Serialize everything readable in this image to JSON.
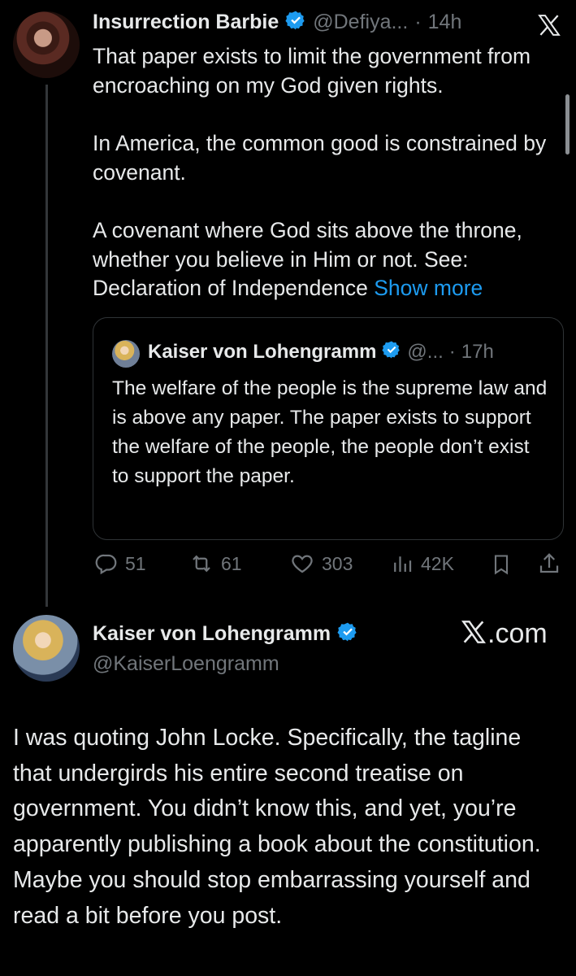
{
  "tweet": {
    "author_name": "Insurrection Barbie",
    "author_handle": "@Defiya...",
    "separator": "·",
    "time": "14h",
    "text": [
      "That paper exists to limit the government from encroaching on my God given rights.",
      "In America, the common good is constrained by covenant.",
      "A covenant where God sits above the throne, whether you believe in Him or not. See: Declaration of Independence"
    ],
    "show_more": "Show more",
    "quoted": {
      "author_name": "Kaiser von Lohengramm",
      "author_handle": "@...",
      "separator": "·",
      "time": "17h",
      "text": "The welfare of the people is the supreme law and is above any paper. The paper exists to support the welfare of the people, the people don’t exist to support the paper."
    },
    "actions": {
      "replies": "51",
      "reposts": "61",
      "likes": "303",
      "views": "42K"
    }
  },
  "reply": {
    "author_name": "Kaiser von Lohengramm",
    "author_handle": "@KaiserLoengramm",
    "watermark": "X.com",
    "text": "I was quoting John Locke. Specifically, the tagline that undergirds his entire second treatise on government. You didn’t know this, and yet, you’re apparently publishing a book about the constitution. Maybe you should stop embarrassing yourself and read a bit before you post."
  },
  "icons": {
    "verified": "verified-badge-icon",
    "x_logo": "x-logo-icon",
    "reply": "reply-icon",
    "repost": "repost-icon",
    "like": "heart-icon",
    "views": "views-icon",
    "bookmark": "bookmark-icon",
    "share": "share-icon"
  },
  "colors": {
    "background": "#000000",
    "text": "#e7e9ea",
    "muted": "#71767b",
    "link": "#1d9bf0",
    "verified": "#1d9bf0"
  }
}
